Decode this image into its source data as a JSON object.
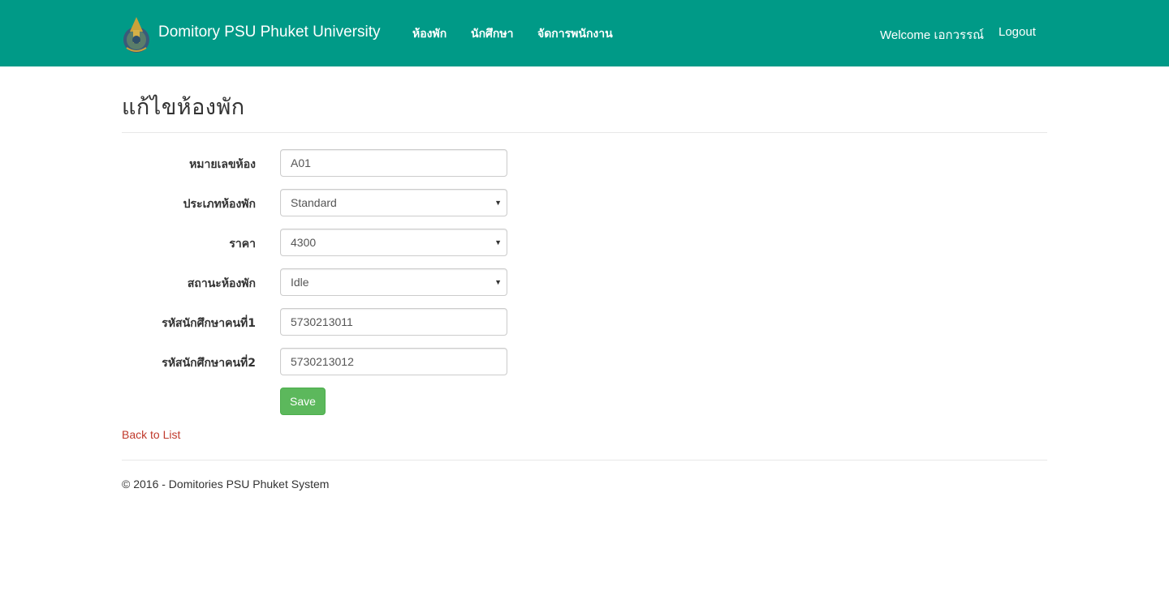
{
  "navbar": {
    "brand": "Domitory PSU Phuket University",
    "links": [
      "ห้องพัก",
      "นักศึกษา",
      "จัดการพนักงาน"
    ],
    "welcome": "Welcome เอกวรรณ์",
    "logout": "Logout",
    "logo_icon": "university-seal-icon",
    "bg_color": "#009a87"
  },
  "page": {
    "title": "แก้ไขห้องพัก"
  },
  "form": {
    "room_number": {
      "label": "หมายเลขห้อง",
      "value": "A01"
    },
    "room_type": {
      "label": "ประเภทห้องพัก",
      "value": "Standard"
    },
    "price": {
      "label": "ราคา",
      "value": "4300"
    },
    "room_status": {
      "label": "สถานะห้องพัก",
      "value": "Idle"
    },
    "student1": {
      "label": "รหัสนักศึกษาคนที่1",
      "value": "5730213011"
    },
    "student2": {
      "label": "รหัสนักศึกษาคนที่2",
      "value": "5730213012"
    },
    "save_label": "Save",
    "save_color": "#5cb85c"
  },
  "back_link": "Back to List",
  "footer": "© 2016 - Domitories PSU Phuket System"
}
